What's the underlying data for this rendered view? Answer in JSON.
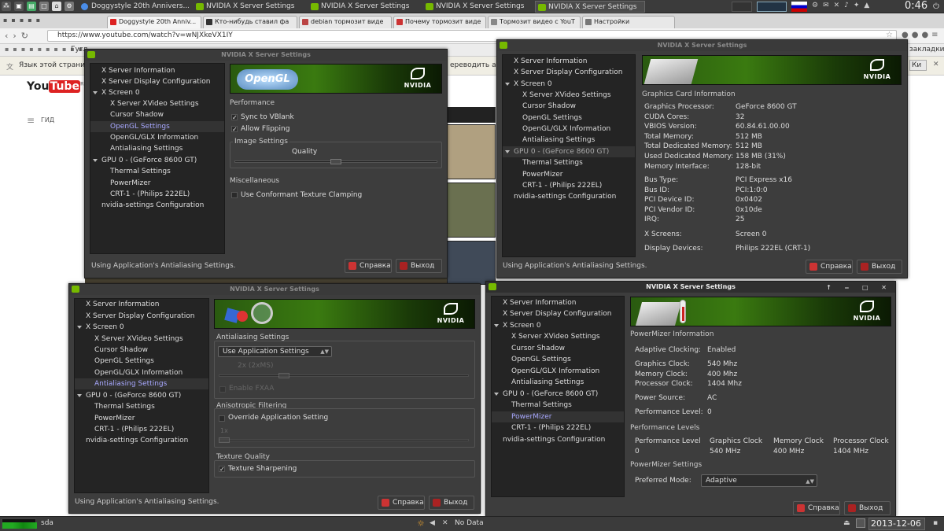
{
  "top_panel": {
    "tasks": [
      {
        "label": "Doggystyle 20th Annivers..."
      },
      {
        "label": "NVIDIA X Server Settings"
      },
      {
        "label": "NVIDIA X Server Settings"
      },
      {
        "label": "NVIDIA X Server Settings"
      },
      {
        "label": "NVIDIA X Server Settings"
      }
    ],
    "clock": "0:46"
  },
  "browser": {
    "tabs": [
      {
        "label": "Doggystyle 20th Anniv..."
      },
      {
        "label": "Кто-нибудь ставил фа"
      },
      {
        "label": "debian тормозит виде"
      },
      {
        "label": "Почему тормозит виде"
      },
      {
        "label": "Тормозит видео с YouT"
      },
      {
        "label": "Настройки"
      }
    ],
    "url": "https://www.youtube.com/watch?v=wNJXkeVX1IY",
    "bookmarks_left": "Гугл",
    "bookmarks_right": "закладки",
    "translate_text": "Язык этой страни",
    "translate_right": "ереводить анг",
    "youtube_guide": "ГИД",
    "youtube_logo": "You",
    "youtube_logo2": "Tube",
    "youtube_ru": "RU",
    "translate_btn": "Ки"
  },
  "colors": {
    "nvidia_green": "#76b900",
    "selected_text": "#a8a8ff"
  },
  "nav": {
    "x_server_information": "X Server Information",
    "x_server_display_configuration": "X Server Display Configuration",
    "x_screen_0": "X Screen 0",
    "x_server_xvideo_settings": "X Server XVideo Settings",
    "cursor_shadow": "Cursor Shadow",
    "opengl_settings": "OpenGL Settings",
    "opengl_glx_information": "OpenGL/GLX Information",
    "antialiasing_settings": "Antialiasing Settings",
    "gpu_0": "GPU 0 - (GeForce 8600 GT)",
    "thermal_settings": "Thermal Settings",
    "powermizer": "PowerMizer",
    "crt_1": "CRT-1 - (Philips 222EL)",
    "nvidia_settings_configuration": "nvidia-settings Configuration"
  },
  "dialog_common": {
    "title": "NVIDIA X Server Settings",
    "help_button": "Справка",
    "quit_button": "Выход",
    "status": "Using Application's Antialiasing Settings.",
    "nvidia_logo_text": "NVIDIA",
    "window_controls": "↑ ‒ □ ✕"
  },
  "opengl": {
    "banner_text": "OpenGL",
    "performance": "Performance",
    "sync_to_vblank": "Sync to VBlank",
    "allow_flipping": "Allow Flipping",
    "image_settings": "Image Settings",
    "quality": "Quality",
    "quality_level": 0.5,
    "miscellaneous": "Miscellaneous",
    "conformant_clamping": "Use Conformant Texture Clamping"
  },
  "gpu_info": {
    "heading": "Graphics Card Information",
    "rows": [
      {
        "label": "Graphics Processor:",
        "value": "GeForce 8600 GT"
      },
      {
        "label": "CUDA Cores:",
        "value": "32"
      },
      {
        "label": "VBIOS Version:",
        "value": "60.84.61.00.00"
      },
      {
        "label": "Total Memory:",
        "value": "512 MB"
      },
      {
        "label": "Total Dedicated Memory:",
        "value": "512 MB"
      },
      {
        "label": "Used Dedicated Memory:",
        "value": "158 MB (31%)"
      },
      {
        "label": "Memory Interface:",
        "value": "128-bit"
      }
    ],
    "bus_rows": [
      {
        "label": "Bus Type:",
        "value": "PCI Express x16"
      },
      {
        "label": "Bus ID:",
        "value": "PCI:1:0:0"
      },
      {
        "label": "PCI Device ID:",
        "value": "0x0402"
      },
      {
        "label": "PCI Vendor ID:",
        "value": "0x10de"
      },
      {
        "label": "IRQ:",
        "value": "25"
      }
    ],
    "x_screens_label": "X Screens:",
    "x_screens_value": "Screen 0",
    "display_devices_label": "Display Devices:",
    "display_devices_value": "Philips 222EL (CRT-1)"
  },
  "antialiasing": {
    "section": "Antialiasing Settings",
    "mode": "Use Application Settings",
    "level_label": "2x (2xMS)",
    "level_fraction": 0.25,
    "fxaa": "Enable FXAA",
    "aniso_section": "Anisotropic Filtering",
    "override": "Override Application Setting",
    "aniso_value": "1x",
    "texture_quality": "Texture Quality",
    "texture_sharpening": "Texture Sharpening"
  },
  "powermizer": {
    "heading": "PowerMizer Information",
    "adaptive_label": "Adaptive Clocking:",
    "adaptive_value": "Enabled",
    "clocks": [
      {
        "label": "Graphics Clock:",
        "value": "540 Mhz"
      },
      {
        "label": "Memory Clock:",
        "value": "400 Mhz"
      },
      {
        "label": "Processor Clock:",
        "value": "1404 Mhz"
      }
    ],
    "power_source_label": "Power Source:",
    "power_source_value": "AC",
    "perf_level_label": "Performance Level:",
    "perf_level_value": "0",
    "perf_levels_heading": "Performance Levels",
    "table_headers": [
      "Performance Level",
      "Graphics Clock",
      "Memory Clock",
      "Processor Clock"
    ],
    "table_row": [
      "0",
      "540 MHz",
      "400 MHz",
      "1404 MHz"
    ],
    "settings_heading": "PowerMizer Settings",
    "preferred_label": "Preferred Mode:",
    "preferred_value": "Adaptive"
  },
  "bottom_panel": {
    "sda": "sda",
    "no_data": "No Data",
    "date": "2013-12-06"
  }
}
